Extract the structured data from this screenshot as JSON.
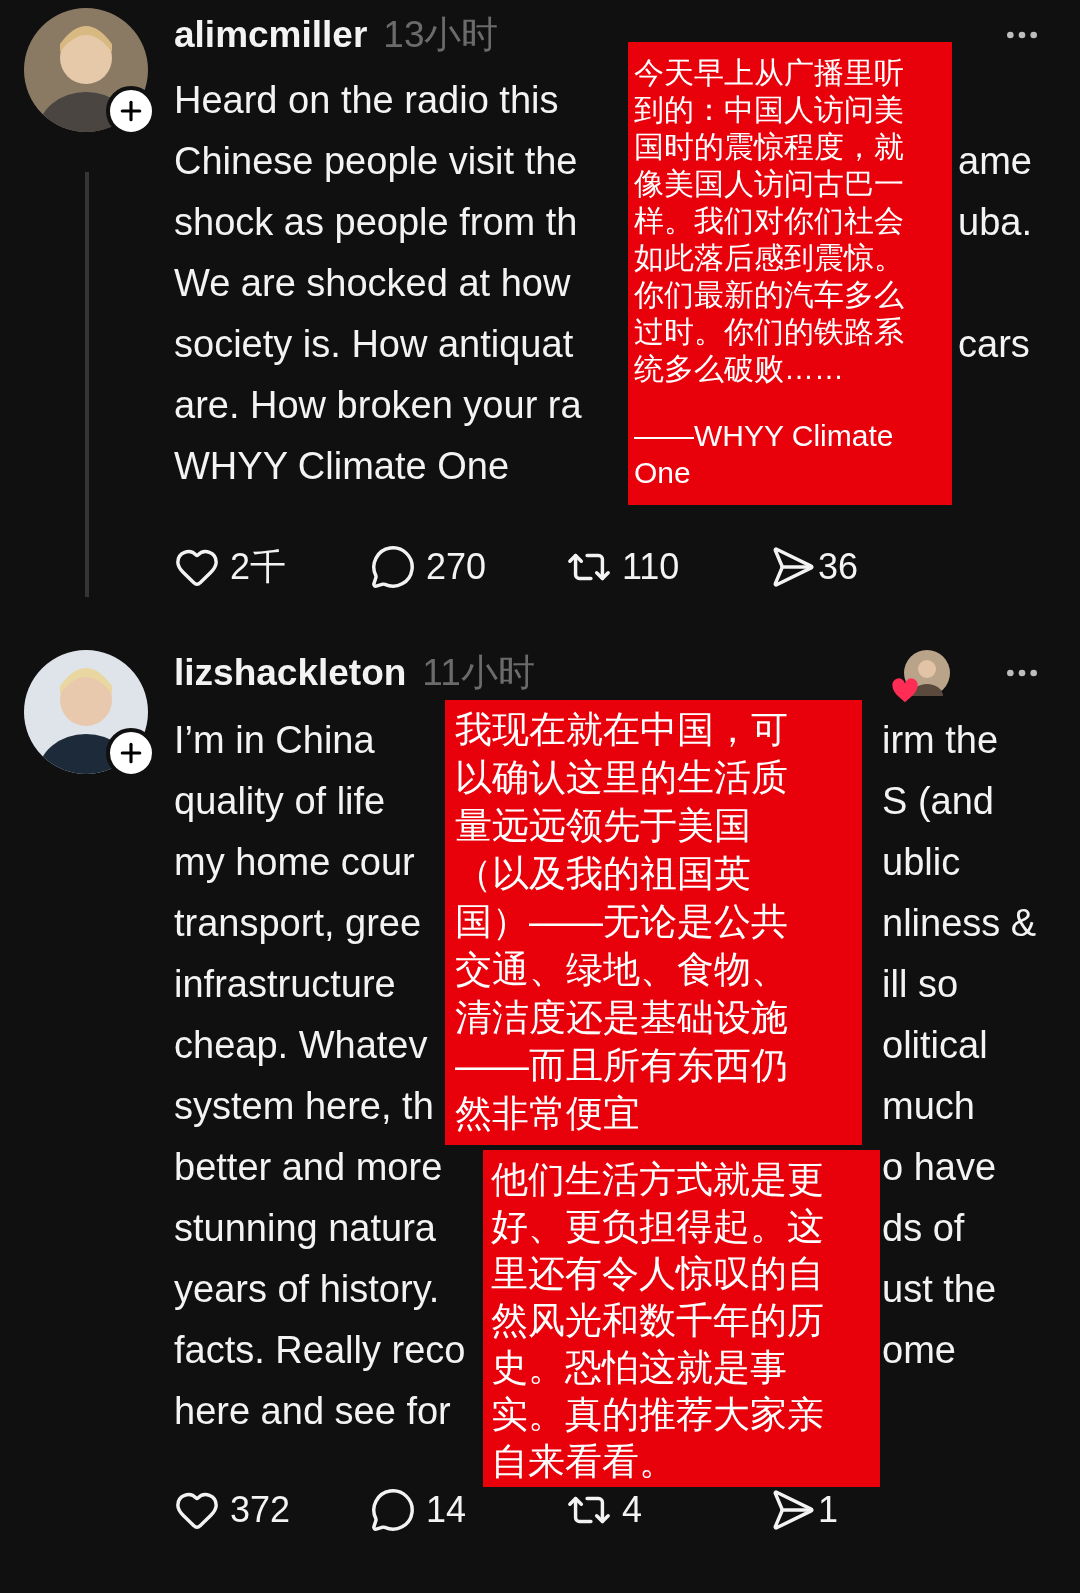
{
  "posts": [
    {
      "username": "alimcmiller",
      "time": "13小时",
      "liked_by_following": false,
      "thread_line": true,
      "lines": [
        {
          "left": "Heard on the radio this"
        },
        {
          "left": "Chinese people visit the",
          "right": "ame"
        },
        {
          "left": "shock as people from th",
          "right": "uba."
        },
        {
          "left": "We are shocked at how"
        },
        {
          "left": "society is. How antiquat",
          "right": "cars"
        },
        {
          "left": "are. How broken your ra"
        },
        {
          "left": "WHYY Climate One"
        }
      ],
      "overlays": [
        {
          "paragraphs": [
            "今天早上从广播里听到的：中国人访问美国时的震惊程度，就像美国人访问古巴一样。我们对你们社会如此落后感到震惊。你们最新的汽车多么过时。你们的铁路系统多么破败……",
            "——WHYY Climate One"
          ]
        }
      ],
      "actions": [
        {
          "kind": "like",
          "count": "2千"
        },
        {
          "kind": "comment",
          "count": "270"
        },
        {
          "kind": "repost",
          "count": "110"
        },
        {
          "kind": "share",
          "count": "36"
        }
      ]
    },
    {
      "username": "lizshackleton",
      "time": "11小时",
      "liked_by_following": true,
      "thread_line": false,
      "lines": [
        {
          "left": "I’m in China",
          "right": "irm the"
        },
        {
          "left": "quality of life",
          "right": "S (and"
        },
        {
          "left": "my home cour",
          "right": "ublic"
        },
        {
          "left": "transport, gree",
          "right": "nliness &"
        },
        {
          "left": "infrastructure",
          "right": "ill so"
        },
        {
          "left": "cheap. Whatev",
          "right": "olitical"
        },
        {
          "left": "system here, th",
          "right": "much"
        },
        {
          "left": "better and more",
          "right": "o have"
        },
        {
          "left": "stunning natura",
          "right": "ds of"
        },
        {
          "left": "years of history.",
          "right": "ust the"
        },
        {
          "left": "facts. Really reco",
          "right": "ome"
        },
        {
          "left": "here and see for"
        }
      ],
      "overlays": [
        {
          "paragraphs": [
            "我现在就在中国，可以确认这里的生活质量远远领先于美国（以及我的祖国英国）——无论是公共交通、绿地、食物、清洁度还是基础设施——而且所有东西仍然非常便宜"
          ]
        },
        {
          "paragraphs": [
            "他们生活方式就是更好、更负担得起。这里还有令人惊叹的自然风光和数千年的历史。恐怕这就是事实。真的推荐大家亲自来看看。"
          ]
        }
      ],
      "actions": [
        {
          "kind": "like",
          "count": "372"
        },
        {
          "kind": "comment",
          "count": "14"
        },
        {
          "kind": "repost",
          "count": "4"
        },
        {
          "kind": "share",
          "count": "1"
        }
      ]
    }
  ]
}
